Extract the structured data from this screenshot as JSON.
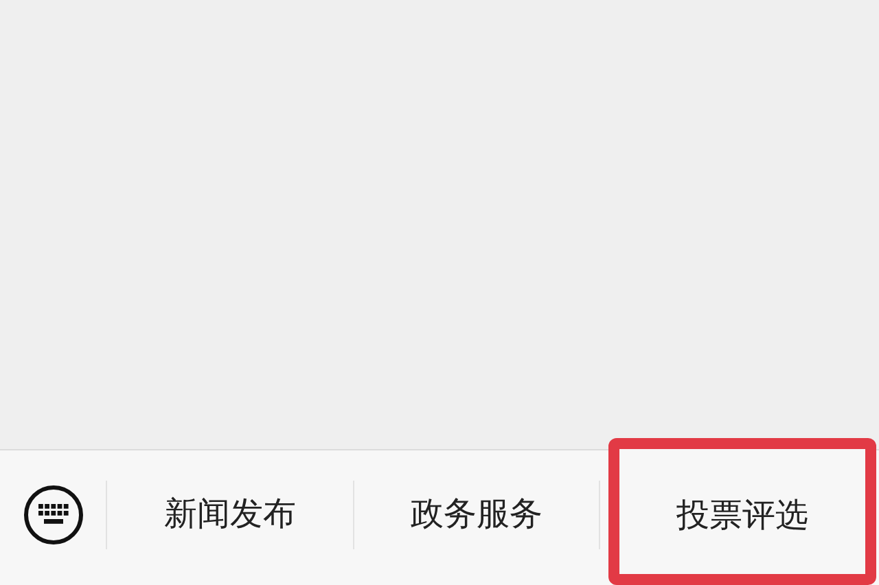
{
  "menu_items": [
    {
      "label": "新闻发布",
      "highlighted": false
    },
    {
      "label": "政务服务",
      "highlighted": false
    },
    {
      "label": "投票评选",
      "highlighted": true
    }
  ]
}
